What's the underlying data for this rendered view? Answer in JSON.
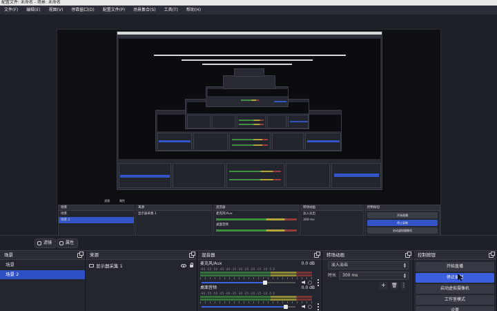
{
  "window": {
    "title": "配置文件: 未命名 - 场景: 未命名"
  },
  "menu": [
    "文件(F)",
    "编辑(E)",
    "视图(V)",
    "停靠窗口(D)",
    "配置文件(P)",
    "场景集合(S)",
    "工具(T)",
    "帮助(H)"
  ],
  "toolbar": {
    "filters_label": "滤镜",
    "properties_label": "属性"
  },
  "docks": {
    "scenes": {
      "title": "场景",
      "items": [
        "场景",
        "场景 2"
      ]
    },
    "sources": {
      "title": "来源",
      "items": [
        {
          "name": "显示器采集 1"
        }
      ]
    },
    "mixer": {
      "title": "混音器",
      "channels": [
        {
          "name": "麦克风/Aux",
          "db": "0.0 dB",
          "scale": "-60 -55 -50 -45 -40 -35 -30 -25 -20 -15 -10 -5 0",
          "volume_fraction": 0.68
        },
        {
          "name": "桌面音频",
          "db": "0.0 dB",
          "scale": "-60 -55 -50 -45 -40 -35 -30 -25 -20 -15 -10 -5 0",
          "volume_fraction": 0.9
        }
      ]
    },
    "transitions": {
      "title": "转场动画",
      "type": "淡入淡出",
      "duration_label": "时长",
      "duration_value": "300 ms"
    },
    "controls": {
      "title": "控制按钮",
      "buttons": [
        "开始直播",
        "停止录制",
        "启动虚拟摄像机",
        "工作室模式",
        "设置"
      ],
      "active_index": 1
    }
  },
  "preview_mini": {
    "scenes_title": "场景",
    "sources_title": "来源",
    "mixer_title": "混音器",
    "transitions_title": "转场动画",
    "controls_title": "控制按钮",
    "scene_items": [
      "场景",
      "场景 2"
    ],
    "source_item": "显示器采集 1",
    "mic": "麦克风/Aux",
    "desktop": "桌面音频",
    "trans_type": "淡入淡出",
    "trans_dur": "300 ms",
    "ctl_buttons": [
      "开始直播",
      "停止录制",
      "启动虚拟摄像机",
      "工作室模式",
      "设置"
    ],
    "toolbar_filters": "滤镜",
    "toolbar_props": "属性"
  }
}
